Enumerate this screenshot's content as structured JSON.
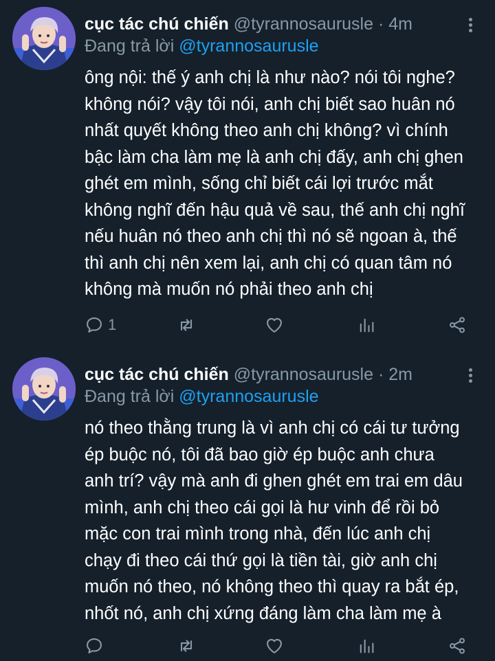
{
  "tweets": [
    {
      "display_name": "cục tác chú chiến",
      "handle": "@tyrannosaurusle",
      "separator": "·",
      "time": "4m",
      "reply_prefix": "Đang trả lời ",
      "reply_mention": "@tyrannosaurusle",
      "body_lines": [
        "ông nội: thế ý anh chị là như nào? nói tôi nghe?",
        "không nói? vậy tôi nói, anh chị biết sao huân nó",
        "nhất quyết không theo anh chị không? vì chính",
        "bậc làm cha làm mẹ là anh chị đấy, anh chị ghen",
        "ghét em mình, sống chỉ biết cái lợi trước mắt",
        "không nghĩ đến hậu quả về sau, thế anh chị nghĩ",
        "nếu huân nó theo anh chị thì nó sẽ ngoan à, thế",
        "thì anh chị nên xem lại, anh chị có quan tâm nó",
        "không mà muốn nó phải theo anh chị"
      ],
      "reply_count": "1",
      "icons": [
        "reply-icon",
        "retweet-icon",
        "like-icon",
        "stats-icon",
        "share-icon"
      ]
    },
    {
      "display_name": "cục tác chú chiến",
      "handle": "@tyrannosaurusle",
      "separator": "·",
      "time": "2m",
      "reply_prefix": "Đang trả lời ",
      "reply_mention": "@tyrannosaurusle",
      "body_lines": [
        "nó theo thằng trung là vì anh chị có cái tư tưởng",
        "ép buộc nó, tôi đã bao giờ ép buộc anh chưa",
        "anh trí? vậy mà anh đi ghen ghét em trai em dâu",
        "mình, anh chị theo cái gọi là hư vinh để rồi bỏ",
        "mặc con trai mình trong nhà, đến lúc anh chị",
        "chạy đi theo cái thứ gọi là tiền tài, giờ anh chị",
        "muốn nó theo, nó không theo thì quay ra bắt ép,",
        "nhốt nó, anh chị xứng đáng làm cha làm mẹ à"
      ],
      "reply_count": "",
      "icons": [
        "reply-icon",
        "retweet-icon",
        "like-icon",
        "stats-icon",
        "share-icon"
      ]
    }
  ],
  "colors": {
    "background": "#15202b",
    "text": "#ffffff",
    "muted": "#8899a6",
    "link": "#1da1f2",
    "avatar_bg": "#6d5fc9"
  }
}
